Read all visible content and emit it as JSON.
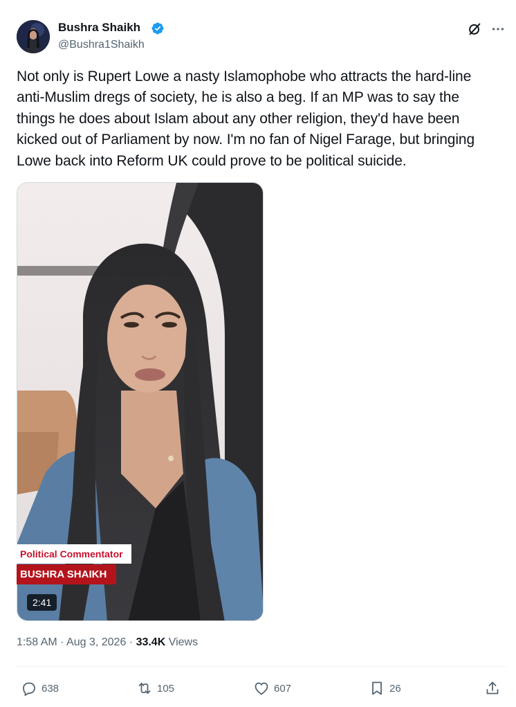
{
  "author": {
    "name": "Bushra Shaikh",
    "handle": "@Bushra1Shaikh",
    "verified": true
  },
  "tweet": {
    "text": "Not only is Rupert Lowe a nasty Islamophobe who attracts the hard-line anti-Muslim dregs of society, he is also a beg. If an MP was to say the things he does about Islam about any other religion, they'd have been kicked out of Parliament by now. I'm no fan of Nigel Farage, but bringing Lowe back into Reform UK could prove to be political suicide."
  },
  "video": {
    "lower_third_title": "Political Commentator",
    "lower_third_name": "BUSHRA SHAIKH",
    "duration": "2:41"
  },
  "meta": {
    "time": "1:58 AM",
    "separator1": " · ",
    "date": "Aug 3, 2026",
    "separator2": " · ",
    "views_count": "33.4K",
    "views_label": " Views"
  },
  "actions": {
    "replies": "638",
    "reposts": "105",
    "likes": "607",
    "bookmarks": "26"
  },
  "icons": {
    "verified": "verified-badge-icon",
    "grok": "grok-icon",
    "more": "more-icon",
    "reply": "reply-icon",
    "repost": "repost-icon",
    "like": "like-icon",
    "bookmark": "bookmark-icon",
    "share": "share-icon"
  },
  "colors": {
    "accent": "#1d9bf0",
    "text": "#0f1419",
    "secondary": "#536471",
    "lower_third_red": "#b3141c"
  }
}
